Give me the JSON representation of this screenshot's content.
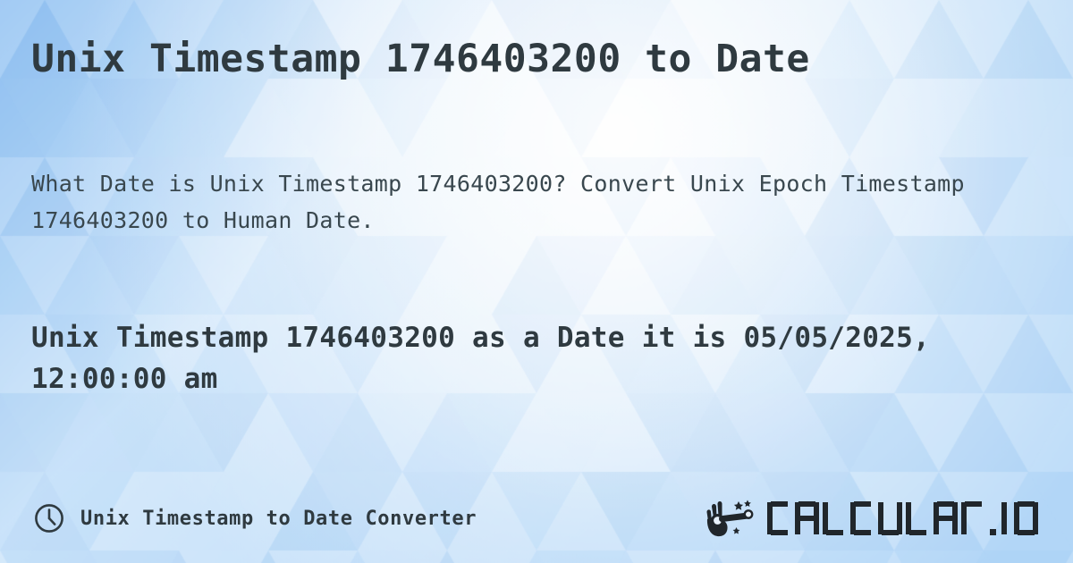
{
  "page": {
    "title": "Unix Timestamp 1746403200 to Date",
    "description": "What Date is Unix Timestamp 1746403200? Convert Unix Epoch Timestamp 1746403200 to Human Date.",
    "result": "Unix Timestamp 1746403200 as a Date it is 05/05/2025, 12:00:00 am",
    "timestamp": "1746403200",
    "human_date": "05/05/2025, 12:00:00 am"
  },
  "footer": {
    "icon": "clock-icon",
    "label": "Unix Timestamp to Date Converter",
    "logo": {
      "icon": "magic-wand-hand-icon",
      "text": "CALCULAT.IO"
    }
  },
  "colors": {
    "text_primary": "#2f3a40",
    "text_secondary": "#39474e",
    "background_light": "#f4fafe",
    "background_blue": "#8dc0f0",
    "logo_dark": "#20262b"
  }
}
